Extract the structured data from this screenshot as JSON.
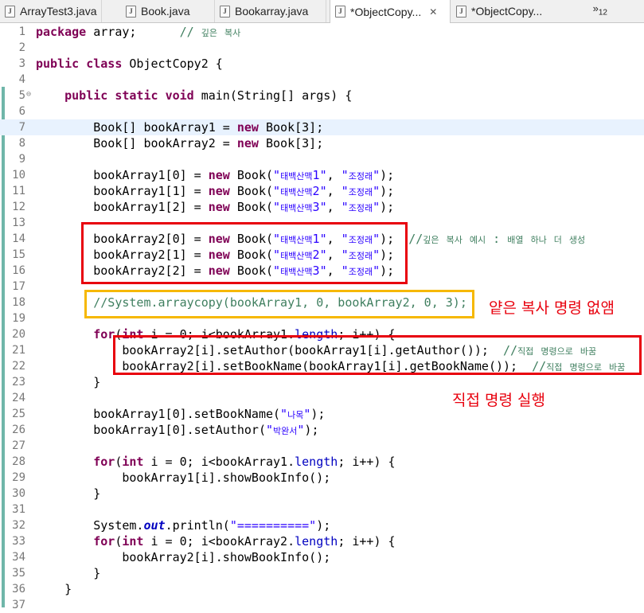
{
  "tabs": [
    {
      "label": "ArrayTest3.java",
      "icon": "java-file-icon",
      "active": false
    },
    {
      "label": "Book.java",
      "icon": "java-file-icon",
      "active": false
    },
    {
      "label": "Bookarray.java",
      "icon": "java-file-icon",
      "active": false
    },
    {
      "label": "*ObjectCopy...",
      "icon": "java-file-icon",
      "active": true
    },
    {
      "label": "*ObjectCopy...",
      "icon": "java-file-icon",
      "active": false
    }
  ],
  "tab_close": "✕",
  "tab_overflow": {
    "chevron": "»",
    "count": "12"
  },
  "fold_marker": "⊖",
  "lines": [
    {
      "n": "1",
      "seg": [
        [
          "kw",
          "package"
        ],
        [
          "t",
          " array;      "
        ],
        [
          "cmt",
          "// 깊은 복사"
        ]
      ]
    },
    {
      "n": "2",
      "seg": []
    },
    {
      "n": "3",
      "seg": [
        [
          "kw",
          "public"
        ],
        [
          "t",
          " "
        ],
        [
          "kw",
          "class"
        ],
        [
          "t",
          " ObjectCopy2 {"
        ]
      ]
    },
    {
      "n": "4",
      "seg": []
    },
    {
      "n": "5",
      "seg": [
        [
          "t",
          "    "
        ],
        [
          "kw",
          "public"
        ],
        [
          "t",
          " "
        ],
        [
          "kw",
          "static"
        ],
        [
          "t",
          " "
        ],
        [
          "kw",
          "void"
        ],
        [
          "t",
          " main(String[] args) {"
        ]
      ]
    },
    {
      "n": "6",
      "seg": []
    },
    {
      "n": "7",
      "seg": [
        [
          "t",
          "        Book[] bookArray1 = "
        ],
        [
          "kw",
          "new"
        ],
        [
          "t",
          " Book[3];"
        ]
      ]
    },
    {
      "n": "8",
      "seg": [
        [
          "t",
          "        Book[] bookArray2 = "
        ],
        [
          "kw",
          "new"
        ],
        [
          "t",
          " Book[3];"
        ]
      ]
    },
    {
      "n": "9",
      "seg": []
    },
    {
      "n": "10",
      "seg": [
        [
          "t",
          "        bookArray1[0] = "
        ],
        [
          "kw",
          "new"
        ],
        [
          "t",
          " Book("
        ],
        [
          "str",
          "\"태백산맥1\""
        ],
        [
          "t",
          ", "
        ],
        [
          "str",
          "\"조정래\""
        ],
        [
          "t",
          ");"
        ]
      ]
    },
    {
      "n": "11",
      "seg": [
        [
          "t",
          "        bookArray1[1] = "
        ],
        [
          "kw",
          "new"
        ],
        [
          "t",
          " Book("
        ],
        [
          "str",
          "\"태백산맥2\""
        ],
        [
          "t",
          ", "
        ],
        [
          "str",
          "\"조정래\""
        ],
        [
          "t",
          ");"
        ]
      ]
    },
    {
      "n": "12",
      "seg": [
        [
          "t",
          "        bookArray1[2] = "
        ],
        [
          "kw",
          "new"
        ],
        [
          "t",
          " Book("
        ],
        [
          "str",
          "\"태백산맥3\""
        ],
        [
          "t",
          ", "
        ],
        [
          "str",
          "\"조정래\""
        ],
        [
          "t",
          ");"
        ]
      ]
    },
    {
      "n": "13",
      "seg": []
    },
    {
      "n": "14",
      "seg": [
        [
          "t",
          "        bookArray2[0] = "
        ],
        [
          "kw",
          "new"
        ],
        [
          "t",
          " Book("
        ],
        [
          "str",
          "\"태백산맥1\""
        ],
        [
          "t",
          ", "
        ],
        [
          "str",
          "\"조정래\""
        ],
        [
          "t",
          ");  "
        ],
        [
          "cmt",
          "//깊은 복사 예시 : 배열 하나 더 생성"
        ]
      ]
    },
    {
      "n": "15",
      "seg": [
        [
          "t",
          "        bookArray2[1] = "
        ],
        [
          "kw",
          "new"
        ],
        [
          "t",
          " Book("
        ],
        [
          "str",
          "\"태백산맥2\""
        ],
        [
          "t",
          ", "
        ],
        [
          "str",
          "\"조정래\""
        ],
        [
          "t",
          ");"
        ]
      ]
    },
    {
      "n": "16",
      "seg": [
        [
          "t",
          "        bookArray2[2] = "
        ],
        [
          "kw",
          "new"
        ],
        [
          "t",
          " Book("
        ],
        [
          "str",
          "\"태백산맥3\""
        ],
        [
          "t",
          ", "
        ],
        [
          "str",
          "\"조정래\""
        ],
        [
          "t",
          ");"
        ]
      ]
    },
    {
      "n": "17",
      "seg": []
    },
    {
      "n": "18",
      "seg": [
        [
          "t",
          "        "
        ],
        [
          "cmt",
          "//System.arraycopy(bookArray1, 0, bookArray2, 0, 3);"
        ]
      ]
    },
    {
      "n": "19",
      "seg": []
    },
    {
      "n": "20",
      "seg": [
        [
          "t",
          "        "
        ],
        [
          "kw",
          "for"
        ],
        [
          "t",
          "("
        ],
        [
          "kw",
          "int"
        ],
        [
          "t",
          " i = 0; i<bookArray1."
        ],
        [
          "fld",
          "length"
        ],
        [
          "t",
          "; i++) {"
        ]
      ]
    },
    {
      "n": "21",
      "seg": [
        [
          "t",
          "            bookArray2[i].setAuthor(bookArray1[i].getAuthor());  "
        ],
        [
          "cmt",
          "//직접 명령으로 바꿈"
        ]
      ]
    },
    {
      "n": "22",
      "seg": [
        [
          "t",
          "            bookArray2[i].setBookName(bookArray1[i].getBookName());  "
        ],
        [
          "cmt",
          "//직접 명령으로 바꿈"
        ]
      ]
    },
    {
      "n": "23",
      "seg": [
        [
          "t",
          "        }"
        ]
      ]
    },
    {
      "n": "24",
      "seg": []
    },
    {
      "n": "25",
      "seg": [
        [
          "t",
          "        bookArray1[0].setBookName("
        ],
        [
          "str",
          "\"나목\""
        ],
        [
          "t",
          ");"
        ]
      ]
    },
    {
      "n": "26",
      "seg": [
        [
          "t",
          "        bookArray1[0].setAuthor("
        ],
        [
          "str",
          "\"박완서\""
        ],
        [
          "t",
          ");"
        ]
      ]
    },
    {
      "n": "27",
      "seg": []
    },
    {
      "n": "28",
      "seg": [
        [
          "t",
          "        "
        ],
        [
          "kw",
          "for"
        ],
        [
          "t",
          "("
        ],
        [
          "kw",
          "int"
        ],
        [
          "t",
          " i = 0; i<bookArray1."
        ],
        [
          "fld",
          "length"
        ],
        [
          "t",
          "; i++) {"
        ]
      ]
    },
    {
      "n": "29",
      "seg": [
        [
          "t",
          "            bookArray1[i].showBookInfo();"
        ]
      ]
    },
    {
      "n": "30",
      "seg": [
        [
          "t",
          "        }"
        ]
      ]
    },
    {
      "n": "31",
      "seg": []
    },
    {
      "n": "32",
      "seg": [
        [
          "t",
          "        System."
        ],
        [
          "sfld",
          "out"
        ],
        [
          "t",
          ".println("
        ],
        [
          "str",
          "\"==========\""
        ],
        [
          "t",
          ");"
        ]
      ]
    },
    {
      "n": "33",
      "seg": [
        [
          "t",
          "        "
        ],
        [
          "kw",
          "for"
        ],
        [
          "t",
          "("
        ],
        [
          "kw",
          "int"
        ],
        [
          "t",
          " i = 0; i<bookArray2."
        ],
        [
          "fld",
          "length"
        ],
        [
          "t",
          "; i++) {"
        ]
      ]
    },
    {
      "n": "34",
      "seg": [
        [
          "t",
          "            bookArray2[i].showBookInfo();"
        ]
      ]
    },
    {
      "n": "35",
      "seg": [
        [
          "t",
          "        }"
        ]
      ]
    },
    {
      "n": "36",
      "seg": [
        [
          "t",
          "    }"
        ]
      ]
    },
    {
      "n": "37",
      "seg": []
    }
  ],
  "annotations": {
    "shallow_copy_removed": "얕은 복사 명령 없앰",
    "direct_command": "직접 명령 실행"
  },
  "colors": {
    "keyword": "#7f0055",
    "string": "#2a00ff",
    "comment": "#3f7f5f",
    "field": "#0000c0",
    "annotation_red": "#e8000d",
    "annotation_yellow": "#f6b800",
    "current_line": "#e8f2fe"
  }
}
